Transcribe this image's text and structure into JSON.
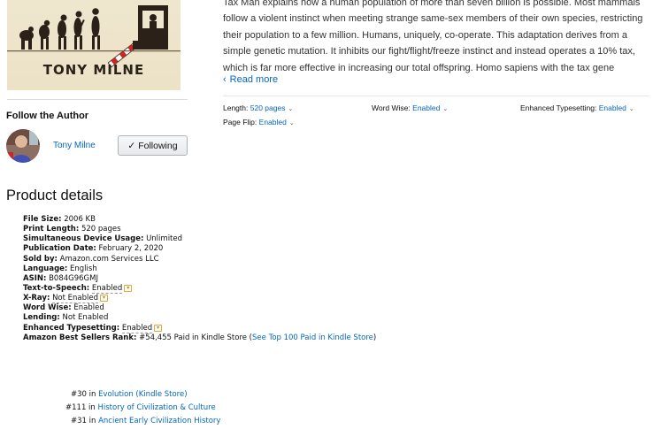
{
  "book": {
    "cover_author": "TONY MILNE"
  },
  "description": {
    "text": "Tax Man explains how a human population of more than seven billion is possible. Most mammals follow a violent instinct when meeting strange same-sex members of their own species, restricting their population to a few million. Humans, uniquely, co-operate. This adaptation derives from a simple genetic mutation. It inhibits our fight/flight/freeze instinct and instead operates a 10% tax, which is far more effective in increasing our total offspring. Homo sapiens with the tax gene",
    "read_more": "Read more",
    "read_more_icon": "chevron-left"
  },
  "meta": {
    "length_label": "Length:",
    "length_value": "520 pages",
    "word_wise_label": "Word Wise:",
    "word_wise_value": "Enabled",
    "typesetting_label": "Enhanced Typesetting:",
    "typesetting_value": "Enabled",
    "page_flip_label": "Page Flip:",
    "page_flip_value": "Enabled"
  },
  "follow": {
    "title": "Follow the Author",
    "author_name": "Tony Milne",
    "button_label": "Following",
    "button_icon": "checkmark"
  },
  "product_details": {
    "heading": "Product details",
    "items": [
      {
        "key": "File Size:",
        "value": "2006 KB"
      },
      {
        "key": "Print Length:",
        "value": "520 pages"
      },
      {
        "key": "Simultaneous Device Usage:",
        "value": "Unlimited"
      },
      {
        "key": "Publication Date:",
        "value": "February 2, 2020"
      },
      {
        "key": "Sold by:",
        "value": "Amazon.com Services LLC"
      },
      {
        "key": "Language:",
        "value": "English"
      },
      {
        "key": "ASIN:",
        "value": "B084G96GMJ"
      },
      {
        "key": "Text-to-Speech:",
        "value": "Enabled"
      },
      {
        "key": "X-Ray:",
        "value": "Not Enabled"
      },
      {
        "key": "Word Wise:",
        "value": "Enabled"
      },
      {
        "key": "Lending:",
        "value": "Not Enabled"
      },
      {
        "key": "Enhanced Typesetting:",
        "value": "Enabled"
      },
      {
        "key": "Amazon Best Sellers Rank:",
        "value": "#54,455 Paid in Kindle Store (",
        "link": "See Top 100 Paid in Kindle Store",
        "tail": ")"
      }
    ],
    "sub_ranks": [
      {
        "rank": "#30 in",
        "category": "Evolution (Kindle Store)"
      },
      {
        "rank": "#111 in",
        "category": "History of Civilization & Culture"
      },
      {
        "rank": "#31 in",
        "category": "Ancient Early Civilization History"
      }
    ]
  },
  "colors": {
    "link": "#0066c0",
    "text": "#111111",
    "description_text": "#333333",
    "dropdown_accent": "#e4a636"
  }
}
